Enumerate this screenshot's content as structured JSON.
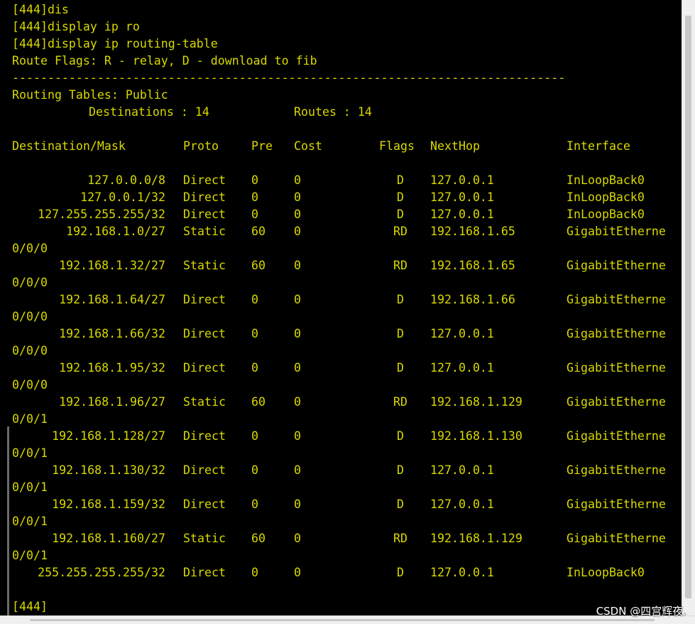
{
  "terminal": {
    "colors": {
      "background": "#000000",
      "text": "#d8d800"
    },
    "commands": [
      "[444]dis",
      "[444]display ip ro",
      "[444]display ip routing-table"
    ],
    "route_flags": "Route Flags: R - relay, D - download to fib",
    "separator": "------------------------------------------------------------------------------",
    "table_title": "Routing Tables: Public",
    "destinations_label": "Destinations : 14",
    "routes_label": "Routes : 14",
    "headers": {
      "dest": "Destination/Mask",
      "proto": "Proto",
      "pre": "Pre",
      "cost": "Cost",
      "flags": "Flags",
      "nexthop": "NextHop",
      "iface": "Interface"
    },
    "routes": [
      {
        "dest": "127.0.0.0/8",
        "proto": "Direct",
        "pre": "0",
        "cost": "0",
        "flags": "D",
        "nexthop": "127.0.0.1",
        "iface": "InLoopBack0",
        "wrap": ""
      },
      {
        "dest": "127.0.0.1/32",
        "proto": "Direct",
        "pre": "0",
        "cost": "0",
        "flags": "D",
        "nexthop": "127.0.0.1",
        "iface": "InLoopBack0",
        "wrap": ""
      },
      {
        "dest": "127.255.255.255/32",
        "proto": "Direct",
        "pre": "0",
        "cost": "0",
        "flags": "D",
        "nexthop": "127.0.0.1",
        "iface": "InLoopBack0",
        "wrap": ""
      },
      {
        "dest": "192.168.1.0/27",
        "proto": "Static",
        "pre": "60",
        "cost": "0",
        "flags": "RD",
        "nexthop": "192.168.1.65",
        "iface": "GigabitEtherne",
        "wrap": "0/0/0"
      },
      {
        "dest": "192.168.1.32/27",
        "proto": "Static",
        "pre": "60",
        "cost": "0",
        "flags": "RD",
        "nexthop": "192.168.1.65",
        "iface": "GigabitEtherne",
        "wrap": "0/0/0"
      },
      {
        "dest": "192.168.1.64/27",
        "proto": "Direct",
        "pre": "0",
        "cost": "0",
        "flags": "D",
        "nexthop": "192.168.1.66",
        "iface": "GigabitEtherne",
        "wrap": "0/0/0"
      },
      {
        "dest": "192.168.1.66/32",
        "proto": "Direct",
        "pre": "0",
        "cost": "0",
        "flags": "D",
        "nexthop": "127.0.0.1",
        "iface": "GigabitEtherne",
        "wrap": "0/0/0"
      },
      {
        "dest": "192.168.1.95/32",
        "proto": "Direct",
        "pre": "0",
        "cost": "0",
        "flags": "D",
        "nexthop": "127.0.0.1",
        "iface": "GigabitEtherne",
        "wrap": "0/0/0"
      },
      {
        "dest": "192.168.1.96/27",
        "proto": "Static",
        "pre": "60",
        "cost": "0",
        "flags": "RD",
        "nexthop": "192.168.1.129",
        "iface": "GigabitEtherne",
        "wrap": "0/0/1"
      },
      {
        "dest": "192.168.1.128/27",
        "proto": "Direct",
        "pre": "0",
        "cost": "0",
        "flags": "D",
        "nexthop": "192.168.1.130",
        "iface": "GigabitEtherne",
        "wrap": "0/0/1"
      },
      {
        "dest": "192.168.1.130/32",
        "proto": "Direct",
        "pre": "0",
        "cost": "0",
        "flags": "D",
        "nexthop": "127.0.0.1",
        "iface": "GigabitEtherne",
        "wrap": "0/0/1"
      },
      {
        "dest": "192.168.1.159/32",
        "proto": "Direct",
        "pre": "0",
        "cost": "0",
        "flags": "D",
        "nexthop": "127.0.0.1",
        "iface": "GigabitEtherne",
        "wrap": "0/0/1"
      },
      {
        "dest": "192.168.1.160/27",
        "proto": "Static",
        "pre": "60",
        "cost": "0",
        "flags": "RD",
        "nexthop": "192.168.1.129",
        "iface": "GigabitEtherne",
        "wrap": "0/0/1"
      },
      {
        "dest": "255.255.255.255/32",
        "proto": "Direct",
        "pre": "0",
        "cost": "0",
        "flags": "D",
        "nexthop": "127.0.0.1",
        "iface": "InLoopBack0",
        "wrap": ""
      }
    ],
    "prompt": "[444]"
  },
  "watermark": "CSDN @四宫辉夜."
}
